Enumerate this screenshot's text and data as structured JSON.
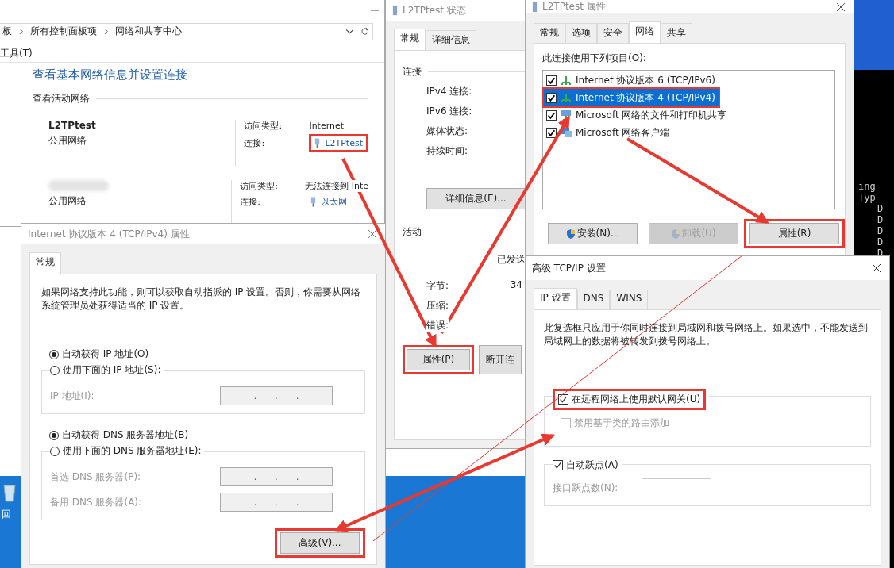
{
  "desktop": {
    "console_lines": [
      "ing Typ",
      "D",
      "D",
      "D",
      "D",
      "D"
    ],
    "icon_label": "回"
  },
  "network_center": {
    "breadcrumb": [
      "板",
      "所有控制面板项",
      "网络和共享中心"
    ],
    "menu": [
      "工具(T)"
    ],
    "heading": "查看基本网络信息并设置连接",
    "section": "查看活动网络",
    "networks": [
      {
        "name": "L2TPtest",
        "type": "公用网络",
        "access_label": "访问类型:",
        "access_value": "Internet",
        "connection_label": "连接:",
        "connection": "L2TPtest"
      },
      {
        "type": "公用网络",
        "access_label": "访问类型:",
        "access_value": "无法连接到 Inte",
        "connection_label": "连接:",
        "connection": "以太网"
      }
    ]
  },
  "status_window": {
    "title": "L2TPtest 状态",
    "tabs": [
      {
        "label": "常规",
        "selected": true
      },
      {
        "label": "详细信息",
        "selected": false
      }
    ],
    "connection_section": "连接",
    "connection_fields": [
      "IPv4 连接:",
      "IPv6 连接:",
      "媒体状态:",
      "持续时间:"
    ],
    "details_button": "详细信息(E)...",
    "activity_section": "活动",
    "sent_header": "已发送",
    "activity_rows": [
      {
        "label": "字节:",
        "value": "34"
      },
      {
        "label": "压缩:"
      },
      {
        "label": "错误:"
      }
    ],
    "buttons": [
      "属性(P)",
      "断开连"
    ]
  },
  "props_window": {
    "title": "L2TPtest 属性",
    "tabs": [
      {
        "label": "常规",
        "selected": false
      },
      {
        "label": "选项",
        "selected": false
      },
      {
        "label": "安全",
        "selected": false
      },
      {
        "label": "网络",
        "selected": true
      },
      {
        "label": "共享",
        "selected": false
      }
    ],
    "list_label": "此连接使用下列项目(O):",
    "items": [
      {
        "label": "Internet 协议版本 6 (TCP/IPv6)",
        "kind": "protocol",
        "checked": true,
        "selected": false
      },
      {
        "label": "Internet 协议版本 4 (TCP/IPv4)",
        "kind": "protocol",
        "checked": true,
        "selected": true
      },
      {
        "label": "Microsoft 网络的文件和打印机共享",
        "kind": "service",
        "checked": true,
        "selected": false
      },
      {
        "label": "Microsoft 网络客户端",
        "kind": "client",
        "checked": true,
        "selected": false
      }
    ],
    "buttons": [
      {
        "label": "安装(N)...",
        "shield": true,
        "disabled": false
      },
      {
        "label": "卸载(U)",
        "shield": true,
        "disabled": true
      },
      {
        "label": "属性(R)",
        "shield": false,
        "disabled": false
      }
    ]
  },
  "ipv4_window": {
    "title": "Internet 协议版本 4 (TCP/IPv4) 属性",
    "tabs": [
      {
        "label": "常规",
        "selected": true
      }
    ],
    "description": "如果网络支持此功能，则可以获取自动指派的 IP 设置。否则，你需要从网络系统管理员处获得适当的 IP 设置。",
    "ip_options": [
      {
        "label": "自动获得 IP 地址(O)",
        "selected": true
      },
      {
        "label": "使用下面的 IP 地址(S):",
        "selected": false
      }
    ],
    "ip_fields": [
      {
        "label": "IP 地址(I):",
        "value": ".      .      ."
      }
    ],
    "dns_options": [
      {
        "label": "自动获得 DNS 服务器地址(B)",
        "selected": true
      },
      {
        "label": "使用下面的 DNS 服务器地址(E):",
        "selected": false
      }
    ],
    "dns_fields": [
      {
        "label": "首选 DNS 服务器(P):",
        "value": ".      .      ."
      },
      {
        "label": "备用 DNS 服务器(A):",
        "value": ".      .      ."
      }
    ],
    "advanced_button": "高级(V)..."
  },
  "advanced_window": {
    "title": "高级 TCP/IP 设置",
    "tabs": [
      {
        "label": "IP 设置",
        "selected": true
      },
      {
        "label": "DNS",
        "selected": false
      },
      {
        "label": "WINS",
        "selected": false
      }
    ],
    "description": "此复选框只应用于你同时连接到局域网和拨号网络上。如果选中，不能发送到局域网上的数据将被转发到拨号网络上。",
    "gateway": {
      "label": "在远程网络上使用默认网关(U)",
      "checked": true,
      "disabled": false
    },
    "class_route": {
      "label": "禁用基于类的路由添加",
      "checked": false,
      "disabled": true
    },
    "auto_metric": {
      "label": "自动跃点(A)",
      "checked": true,
      "disabled": false
    },
    "metric_label": "接口跃点数(N):"
  }
}
